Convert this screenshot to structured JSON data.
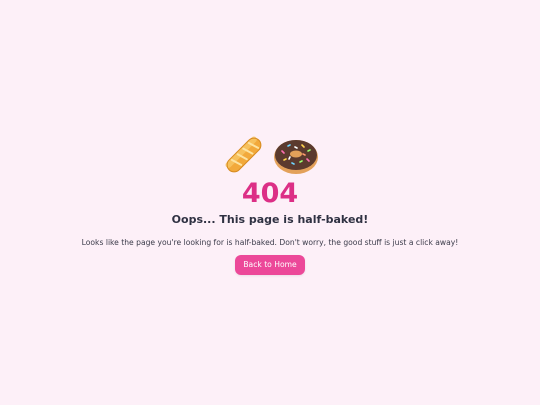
{
  "error": {
    "code": "404",
    "title": "Oops... This page is half-baked!",
    "message": "Looks like the page you're looking for is half-baked. Don't worry, the good stuff is just a click away!"
  },
  "actions": {
    "home_label": "Back to Home"
  },
  "icons": [
    "baguette-icon",
    "donut-icon"
  ],
  "colors": {
    "background": "#fdf0f8",
    "accent": "#dc2f86",
    "button": "#ec4899",
    "heading": "#2f3142"
  }
}
